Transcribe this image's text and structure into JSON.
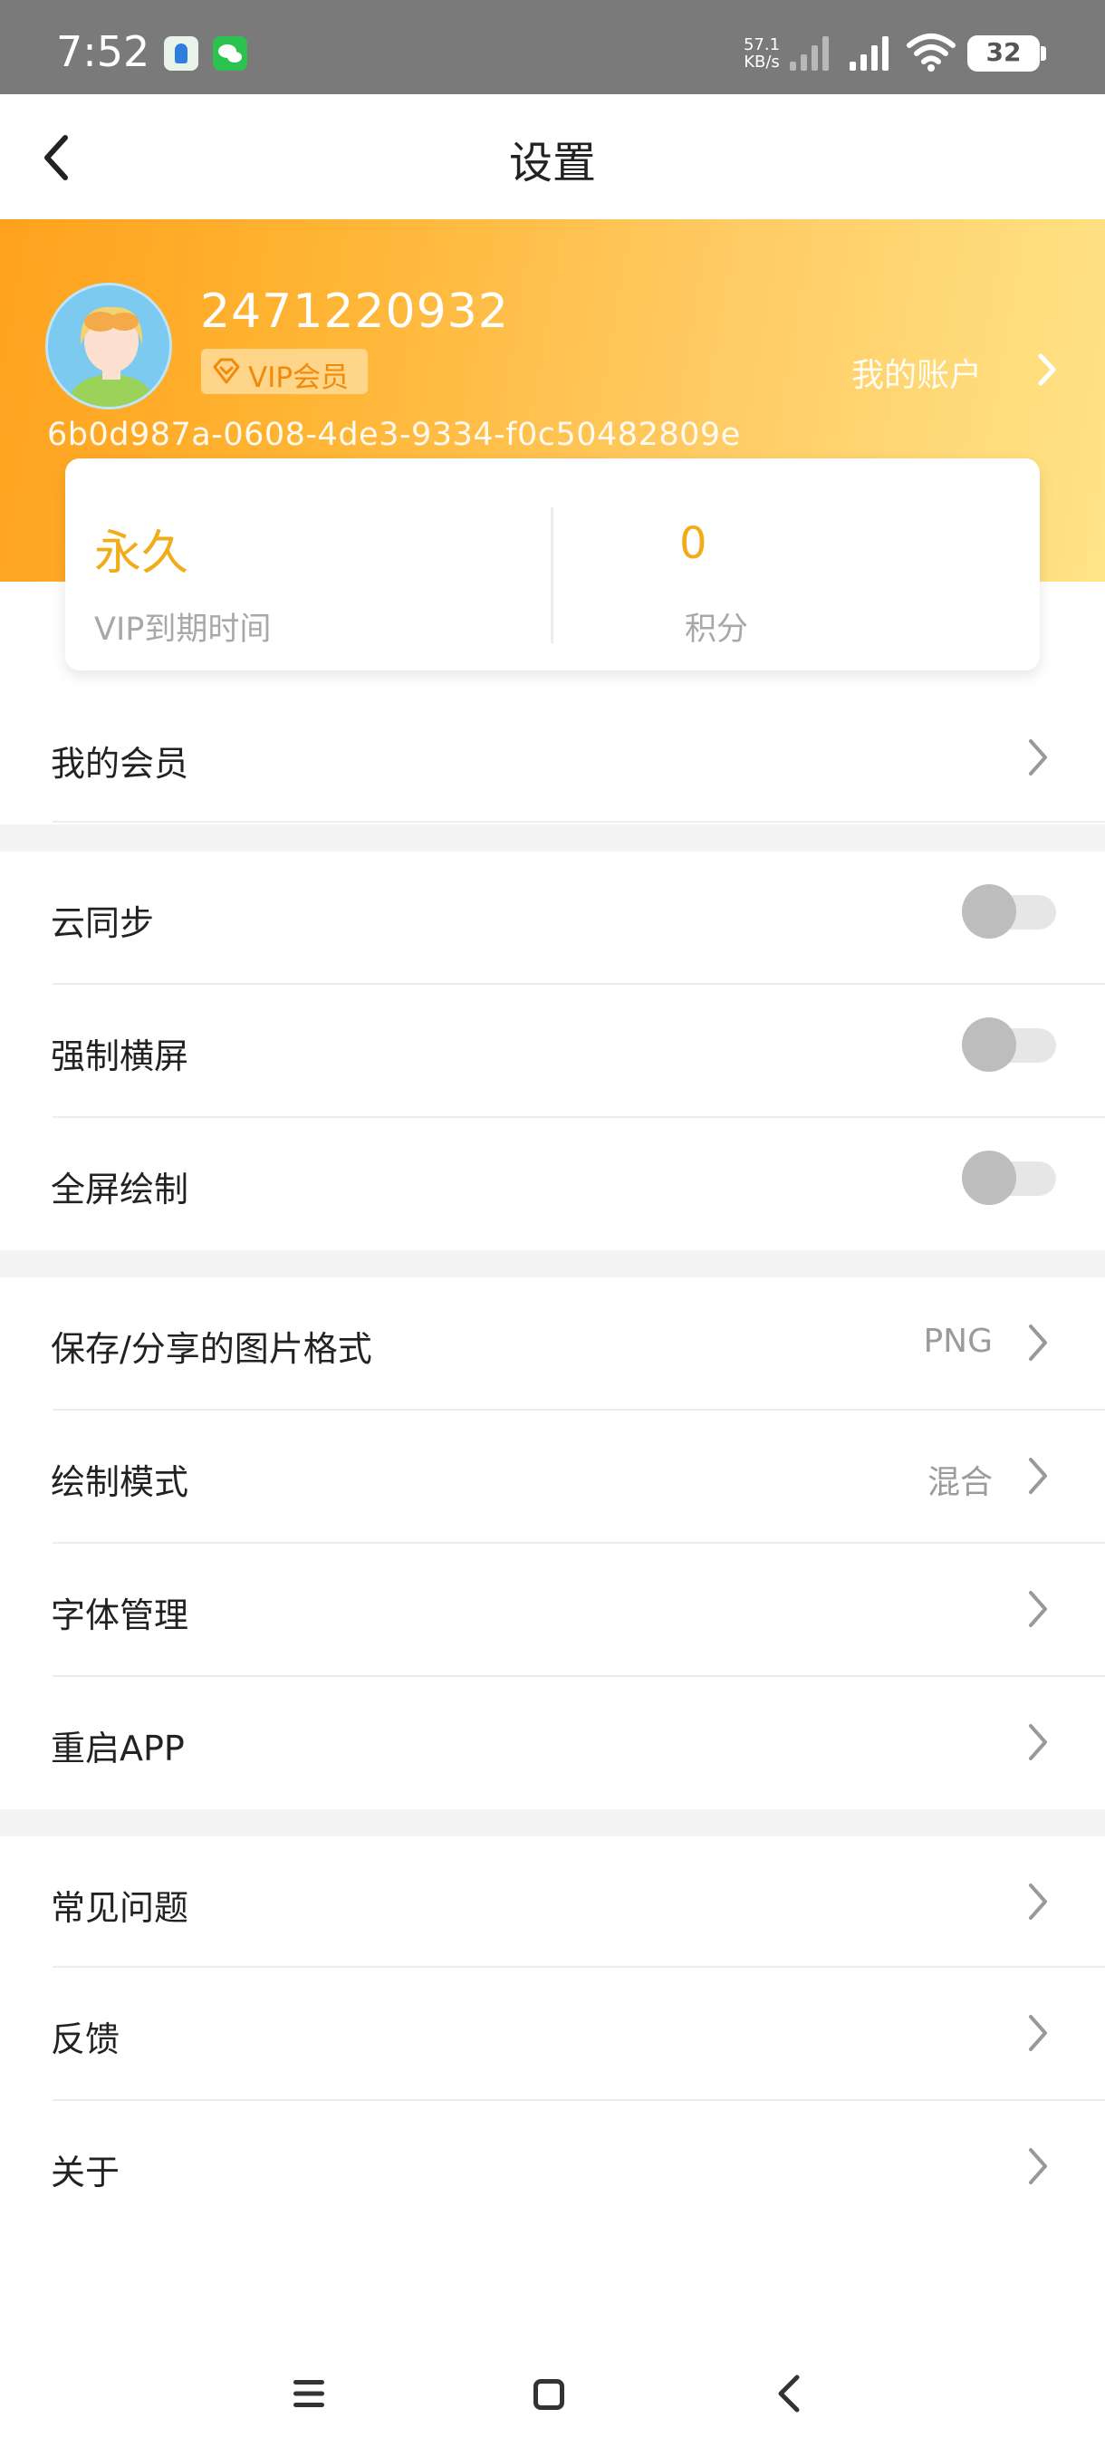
{
  "status_bar": {
    "time": "7:52",
    "network_speed": "57.1",
    "network_unit": "KB/s",
    "battery": "32",
    "notification_icons": [
      "maps-icon",
      "wechat-icon"
    ],
    "system_icons": [
      "signal-icon",
      "wifi-icon",
      "battery-icon"
    ]
  },
  "app_bar": {
    "title": "设置",
    "back_icon": "chevron-left-icon"
  },
  "profile": {
    "username": "2471220932",
    "vip_badge": "VIP会员",
    "account_link": "我的账户",
    "device_id": "6b0d987a-0608-4de3-9334-f0c50482809e",
    "colors": {
      "gradient_start": "#ffa21d",
      "gradient_end": "#ffe487",
      "accent": "#f0ad19"
    }
  },
  "stats": {
    "vip_expiry_value": "永久",
    "vip_expiry_label": "VIP到期时间",
    "points_value": "0",
    "points_label": "积分"
  },
  "sections": {
    "membership": {
      "label": "我的会员"
    },
    "toggles": [
      {
        "label": "云同步",
        "enabled": false
      },
      {
        "label": "强制横屏",
        "enabled": false
      },
      {
        "label": "全屏绘制",
        "enabled": false
      }
    ],
    "options": [
      {
        "label": "保存/分享的图片格式",
        "value": "PNG"
      },
      {
        "label": "绘制模式",
        "value": "混合"
      },
      {
        "label": "字体管理",
        "value": ""
      },
      {
        "label": "重启APP",
        "value": ""
      }
    ],
    "help": [
      {
        "label": "常见问题"
      },
      {
        "label": "反馈"
      },
      {
        "label": "关于"
      }
    ]
  },
  "nav_bar": {
    "icons": [
      "menu-icon",
      "home-icon",
      "back-icon"
    ]
  }
}
